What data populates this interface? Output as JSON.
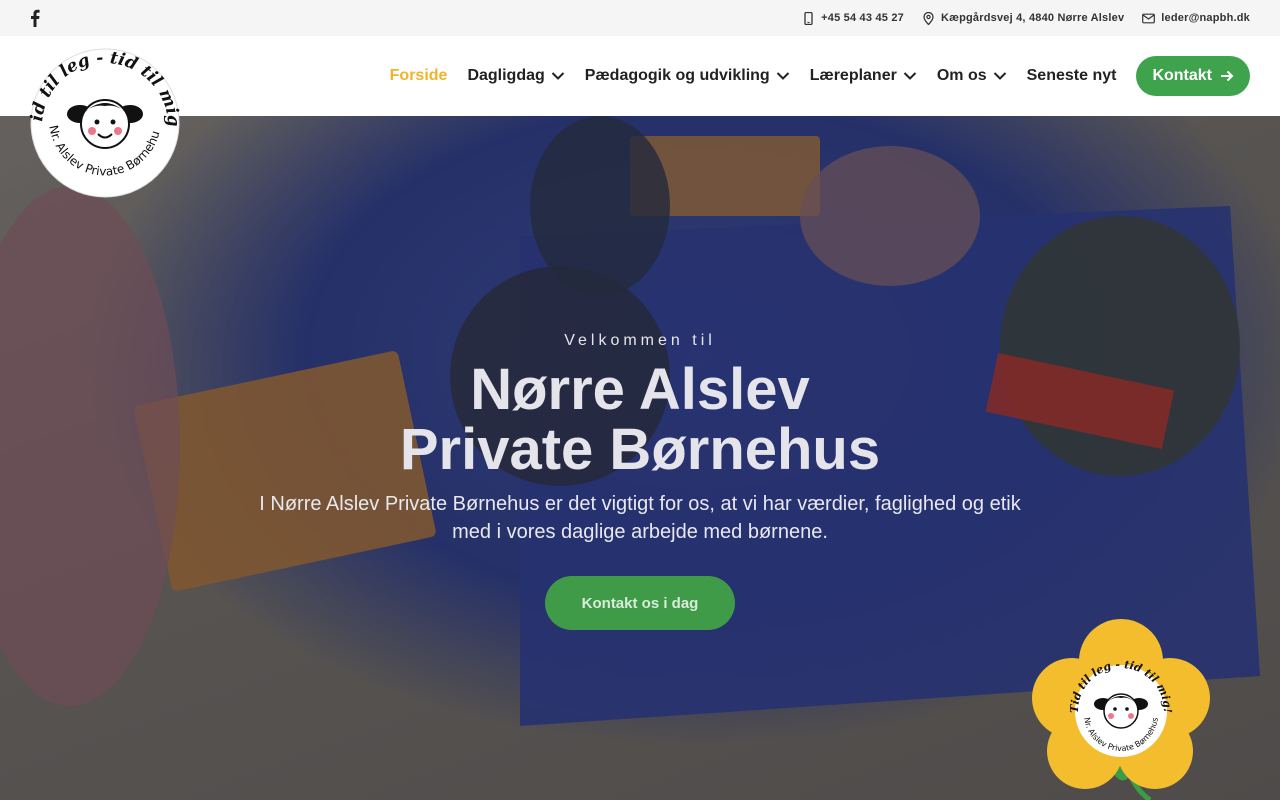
{
  "topbar": {
    "facebook_icon": "facebook-icon",
    "phone": "+45 54 43 45 27",
    "address": "Kæpgårdsvej 4, 4840 Nørre Alslev",
    "email": "leder@napbh.dk"
  },
  "logo": {
    "top_text": "Tid til leg - tid til mig!",
    "bottom_text": "Nr. Alslev Private Børnehus"
  },
  "nav": {
    "items": [
      {
        "label": "Forside",
        "active": true,
        "dropdown": false
      },
      {
        "label": "Dagligdag",
        "active": false,
        "dropdown": true
      },
      {
        "label": "Pædagogik og udvikling",
        "active": false,
        "dropdown": true
      },
      {
        "label": "Læreplaner",
        "active": false,
        "dropdown": true
      },
      {
        "label": "Om os",
        "active": false,
        "dropdown": true
      },
      {
        "label": "Seneste nyt",
        "active": false,
        "dropdown": false
      }
    ],
    "contact_button": "Kontakt"
  },
  "hero": {
    "kicker": "Velkommen til",
    "title_line1": "Nørre Alslev",
    "title_line2": "Private Børnehus",
    "description": "I Nørre Alslev Private Børnehus er det vigtigt for os, at vi har værdier, faglighed og etik med i vores daglige arbejde med børnene.",
    "cta": "Kontakt os i dag"
  },
  "colors": {
    "accent_active": "#f0b429",
    "button_green": "#3fa34d",
    "topbar_bg": "#f5f5f5"
  }
}
